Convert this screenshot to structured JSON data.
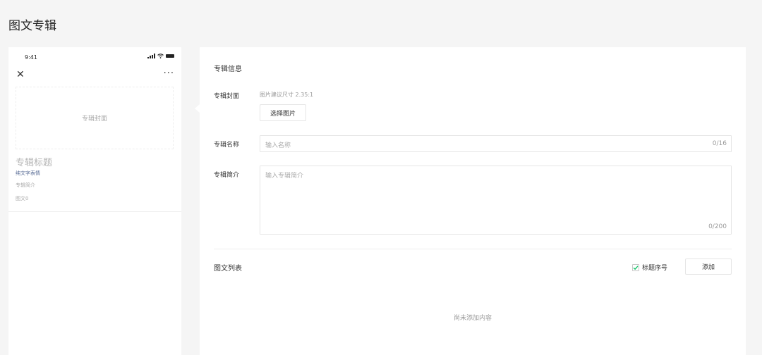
{
  "page": {
    "title": "图文专辑"
  },
  "preview": {
    "status_time": "9:41",
    "close_icon": "close-icon",
    "more_icon": "more-icon",
    "cover_placeholder": "专辑封面",
    "album_title": "专辑标题",
    "album_meta": "纯文字表情",
    "album_intro": "专辑简介",
    "album_count": "图文0"
  },
  "form": {
    "section_title": "专辑信息",
    "cover": {
      "label": "专辑封面",
      "hint": "图片建议尺寸 2.35:1",
      "select_button": "选择图片"
    },
    "name": {
      "label": "专辑名称",
      "placeholder": "输入名称",
      "counter": "0/16"
    },
    "intro": {
      "label": "专辑简介",
      "placeholder": "输入专辑简介",
      "counter": "0/200"
    },
    "list": {
      "title": "图文列表",
      "checkbox_label": "标题序号",
      "checkbox_checked": true,
      "add_button": "添加",
      "empty_text": "尚未添加内容"
    }
  },
  "colors": {
    "accent_green": "#07c160",
    "link_blue": "#576b95",
    "background": "#f5f5f5"
  }
}
